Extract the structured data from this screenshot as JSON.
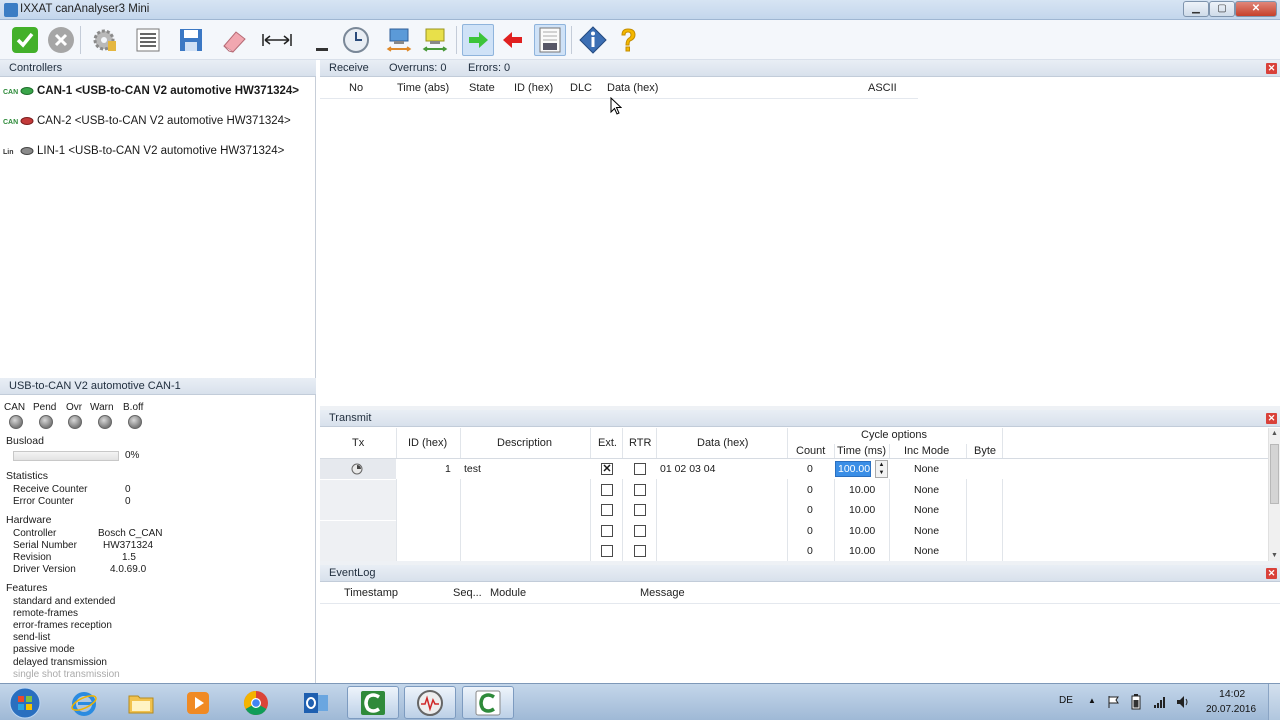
{
  "window": {
    "title": "IXXAT canAnalyser3 Mini",
    "controls": {
      "minimize": "▁",
      "maximize": "▢",
      "close": "✕"
    }
  },
  "toolbar": {
    "buttons": [
      {
        "name": "start-icon"
      },
      {
        "name": "stop-icon"
      },
      {
        "name": "settings-icon"
      },
      {
        "name": "filter-icon"
      },
      {
        "name": "save-icon"
      },
      {
        "name": "clear-icon"
      },
      {
        "name": "column-width-icon"
      },
      {
        "name": "underline-icon"
      },
      {
        "name": "clock-icon"
      },
      {
        "name": "network-send-icon"
      },
      {
        "name": "network-receive-icon"
      },
      {
        "name": "arrow-right-icon"
      },
      {
        "name": "arrow-left-icon"
      },
      {
        "name": "log-icon"
      },
      {
        "name": "info-icon"
      },
      {
        "name": "help-icon"
      }
    ]
  },
  "controllers": {
    "header": "Controllers",
    "items": [
      {
        "label": "CAN-1  <USB-to-CAN V2 automotive  HW371324>",
        "icon": "CAN"
      },
      {
        "label": "CAN-2  <USB-to-CAN V2 automotive  HW371324>",
        "icon": "CAN"
      },
      {
        "label": "LIN-1  <USB-to-CAN V2 automotive  HW371324>",
        "icon": "Lin"
      }
    ]
  },
  "status_panel": {
    "header": "USB-to-CAN V2 automotive  CAN-1",
    "lamps": [
      "CAN",
      "Pend",
      "Ovr",
      "Warn",
      "B.off"
    ],
    "busload_label": "Busload",
    "busload_value": "0%",
    "busload_fraction": 0,
    "statistics_label": "Statistics",
    "receive_counter_label": "Receive Counter",
    "receive_counter_value": "0",
    "error_counter_label": "Error Counter",
    "error_counter_value": "0",
    "hardware_label": "Hardware",
    "controller_label": "Controller",
    "controller_value": "Bosch C_CAN",
    "serial_label": "Serial Number",
    "serial_value": "HW371324",
    "revision_label": "Revision",
    "revision_value": "1.5",
    "driver_label": "Driver Version",
    "driver_value": "4.0.69.0",
    "features_label": "Features",
    "features": [
      "standard and extended",
      "remote-frames",
      "error-frames reception",
      "send-list",
      "passive mode",
      "delayed transmission",
      "single shot transmission"
    ]
  },
  "receive": {
    "title": "Receive",
    "overruns": "Overruns: 0",
    "errors": "Errors: 0",
    "columns": [
      "No",
      "Time (abs)",
      "State",
      "ID (hex)",
      "DLC",
      "Data (hex)",
      "ASCII"
    ]
  },
  "transmit": {
    "title": "Transmit",
    "columns": {
      "tx": "Tx",
      "id": "ID (hex)",
      "description": "Description",
      "ext": "Ext.",
      "rtr": "RTR",
      "data": "Data (hex)",
      "cycle_options": "Cycle options",
      "count": "Count",
      "time": "Time (ms)",
      "inc_mode": "Inc Mode",
      "byte": "Byte"
    },
    "rows": [
      {
        "id": "1",
        "description": "test",
        "ext": true,
        "rtr": false,
        "data": "01 02 03 04",
        "count": "0",
        "time": "100.00",
        "inc_mode": "None"
      },
      {
        "id": "",
        "description": "",
        "ext": false,
        "rtr": false,
        "data": "",
        "count": "0",
        "time": "10.00",
        "inc_mode": "None"
      },
      {
        "id": "",
        "description": "",
        "ext": false,
        "rtr": false,
        "data": "",
        "count": "0",
        "time": "10.00",
        "inc_mode": "None"
      },
      {
        "id": "",
        "description": "",
        "ext": false,
        "rtr": false,
        "data": "",
        "count": "0",
        "time": "10.00",
        "inc_mode": "None"
      },
      {
        "id": "",
        "description": "",
        "ext": false,
        "rtr": false,
        "data": "",
        "count": "0",
        "time": "10.00",
        "inc_mode": "None"
      }
    ]
  },
  "eventlog": {
    "title": "EventLog",
    "columns": [
      "Timestamp",
      "Seq...",
      "Module",
      "Message"
    ]
  },
  "taskbar": {
    "apps": [
      "start-orb",
      "internet-explorer",
      "file-explorer",
      "media-player",
      "chrome",
      "outlook",
      "canalyser-c",
      "canalyser-monitor",
      "canalyser-c2"
    ],
    "lang": "DE",
    "time": "14:02",
    "date": "20.07.2016"
  },
  "colors": {
    "accent": "#3b7dc4",
    "selection": "#3a8ee6",
    "close": "#d9413a"
  }
}
